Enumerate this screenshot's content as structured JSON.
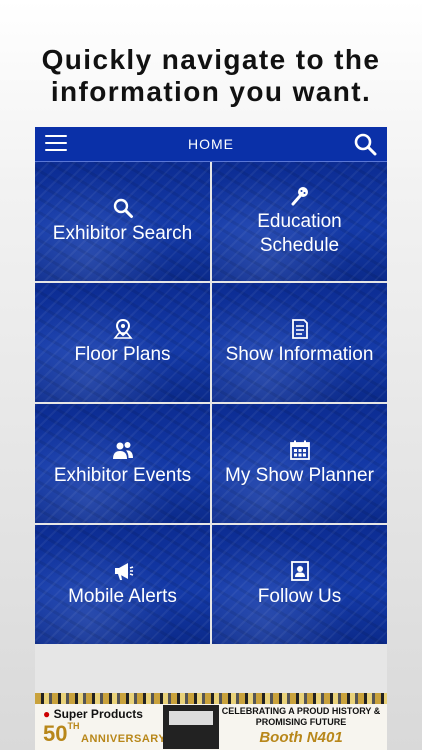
{
  "headline": {
    "line1": "Quickly navigate to the",
    "line2": "information you want."
  },
  "topbar": {
    "title": "HOME",
    "menu_icon": "hamburger-menu-icon",
    "search_icon": "search-icon"
  },
  "tiles": [
    {
      "label": "Exhibitor Search",
      "icon": "search-icon"
    },
    {
      "label": "Education Schedule",
      "icon": "microphone-icon"
    },
    {
      "label": "Floor Plans",
      "icon": "map-pin-icon"
    },
    {
      "label": "Show Information",
      "icon": "document-icon"
    },
    {
      "label": "Exhibitor Events",
      "icon": "people-icon"
    },
    {
      "label": "My Show Planner",
      "icon": "calendar-icon"
    },
    {
      "label": "Mobile Alerts",
      "icon": "megaphone-icon"
    },
    {
      "label": "Follow Us",
      "icon": "contact-card-icon"
    }
  ],
  "ad": {
    "brand": "Super Products",
    "big": "50",
    "big_suffix": "TH",
    "anniversary": "ANNIVERSARY",
    "tagline": "CELEBRATING A PROUD HISTORY & PROMISING FUTURE",
    "booth": "Booth N401"
  },
  "colors": {
    "primary": "#0a30a8",
    "tile": "#143aa8",
    "gold": "#b8871a"
  }
}
